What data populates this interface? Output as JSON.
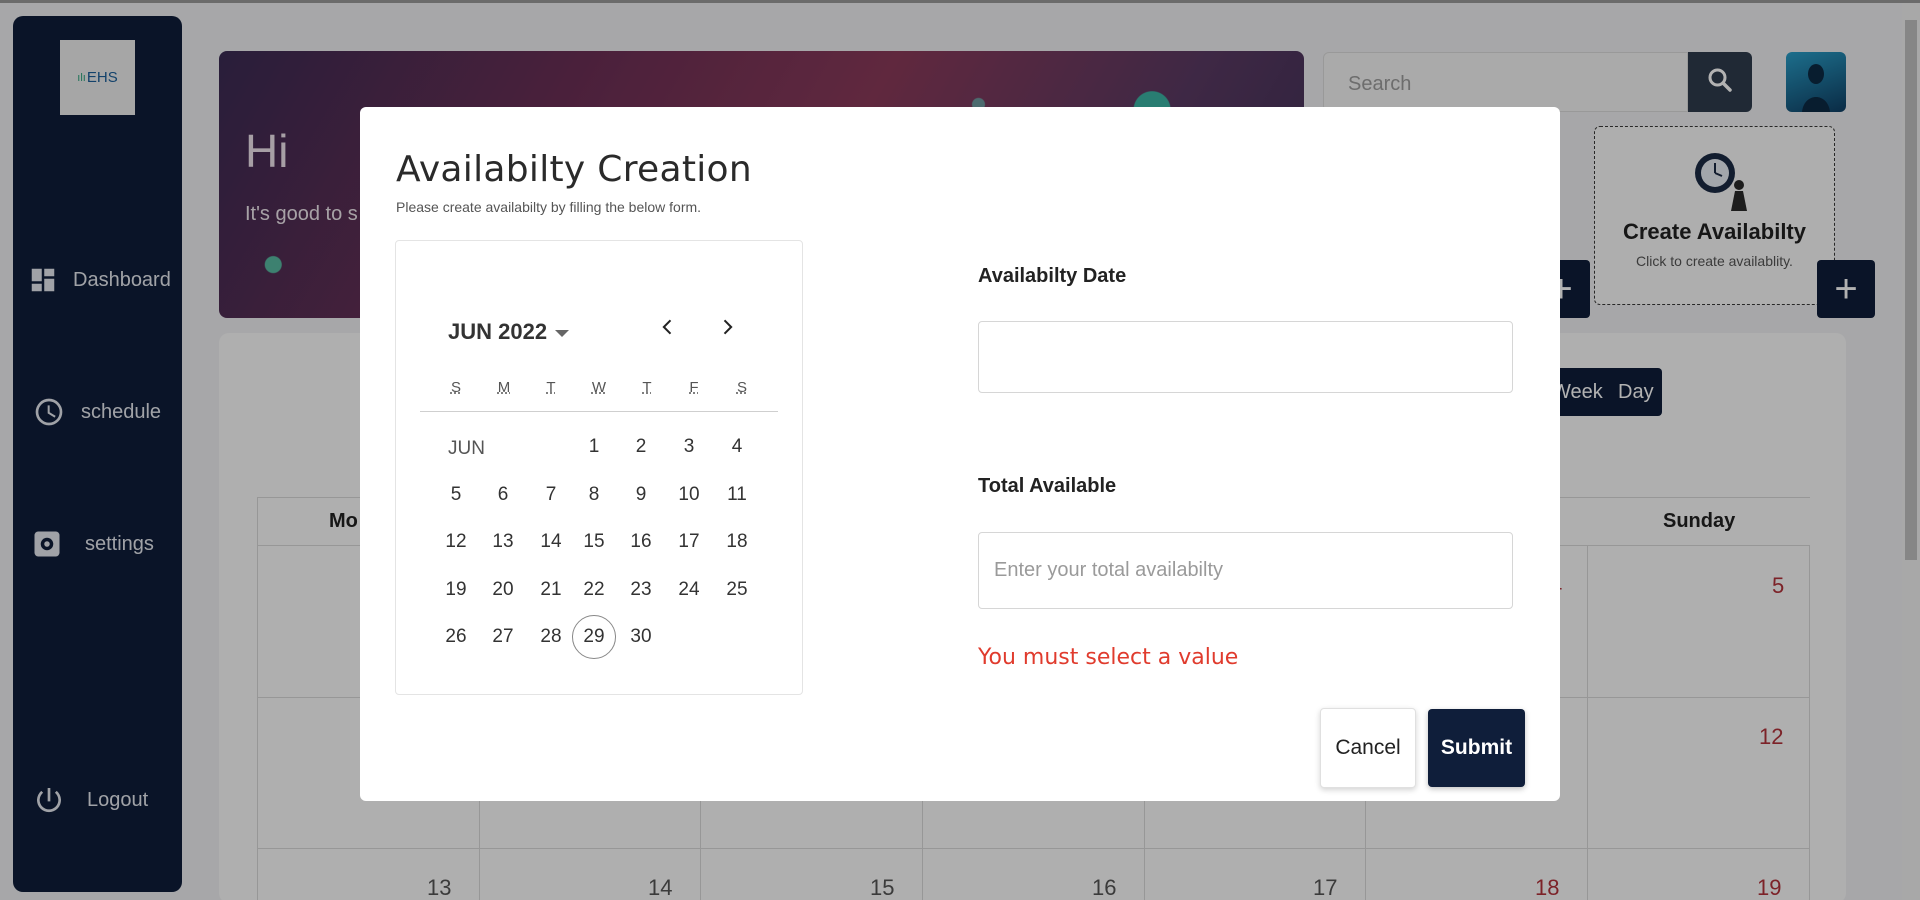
{
  "sidebar": {
    "logo_text": "EHS",
    "items": [
      {
        "label": "Dashboard",
        "icon": "dashboard-icon"
      },
      {
        "label": "schedule",
        "icon": "clock-icon"
      },
      {
        "label": "settings",
        "icon": "gear-icon"
      },
      {
        "label": "Logout",
        "icon": "power-icon"
      }
    ]
  },
  "banner": {
    "greeting": "Hi",
    "subtitle": "It's good to s"
  },
  "search": {
    "placeholder": "Search"
  },
  "create_card": {
    "title": "Create Availabilty",
    "subtitle": "Click to create availablity."
  },
  "calendar": {
    "view_buttons": [
      "Week",
      "Day"
    ],
    "visible_headers": {
      "monday": "Mo",
      "sunday": "Sunday"
    },
    "visible_numbers": {
      "r1_fri_partial": "4",
      "r1_sun": "5",
      "r2_sun": "12",
      "r3": [
        "13",
        "14",
        "15",
        "16",
        "17",
        "18",
        "19"
      ]
    }
  },
  "modal": {
    "title": "Availabilty Creation",
    "subtitle": "Please create availabilty by filling the below form.",
    "datepicker": {
      "month_year": "JUN 2022",
      "weekdays": [
        "S",
        "M",
        "T",
        "W",
        "T",
        "F",
        "S"
      ],
      "month_label": "JUN",
      "days": [
        "1",
        "2",
        "3",
        "4",
        "5",
        "6",
        "7",
        "8",
        "9",
        "10",
        "11",
        "12",
        "13",
        "14",
        "15",
        "16",
        "17",
        "18",
        "19",
        "20",
        "21",
        "22",
        "23",
        "24",
        "25",
        "26",
        "27",
        "28",
        "29",
        "30"
      ],
      "today": "29"
    },
    "date_field": {
      "label": "Availabilty Date",
      "value": ""
    },
    "total_field": {
      "label": "Total Available",
      "placeholder": "Enter your total availabilty",
      "value": ""
    },
    "error": "You must select a value",
    "cancel_label": "Cancel",
    "submit_label": "Submit"
  },
  "colors": {
    "navy": "#0f1e3a",
    "error": "#e03b2d",
    "weekend_red": "#b2323a"
  }
}
